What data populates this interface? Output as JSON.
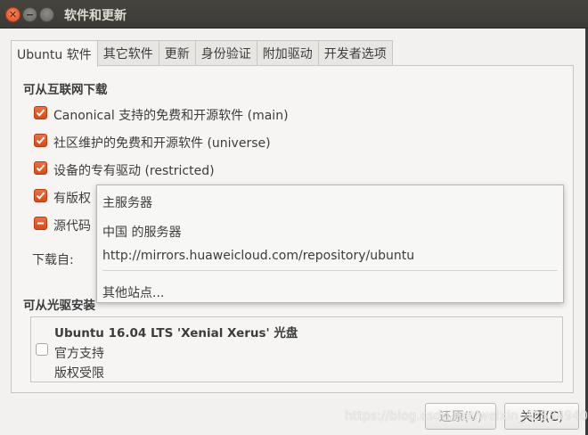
{
  "window": {
    "title": "软件和更新"
  },
  "tabs": [
    {
      "label": "Ubuntu 软件",
      "active": true
    },
    {
      "label": "其它软件"
    },
    {
      "label": "更新"
    },
    {
      "label": "身份验证"
    },
    {
      "label": "附加驱动"
    },
    {
      "label": "开发者选项"
    }
  ],
  "internet": {
    "heading": "可从互联网下载",
    "options": [
      {
        "label": "Canonical 支持的免费和开源软件 (main)",
        "checked": true
      },
      {
        "label": "社区维护的免费和开源软件 (universe)",
        "checked": true
      },
      {
        "label": "设备的专有驱动 (restricted)",
        "checked": true
      },
      {
        "label": "有版权",
        "checked": true
      },
      {
        "label": "源代码",
        "checked": "mixed"
      }
    ],
    "download_from_label": "下载自:"
  },
  "server_menu": {
    "items": [
      "主服务器",
      "中国 的服务器",
      "http://mirrors.huaweicloud.com/repository/ubuntu",
      "其他站点..."
    ]
  },
  "cdrom": {
    "heading": "可从光驱安装",
    "entry_title": "Ubuntu 16.04 LTS 'Xenial Xerus' 光盘",
    "entry_lines": [
      "官方支持",
      "版权受限"
    ]
  },
  "buttons": {
    "revert": "还原(V)",
    "close": "关闭(C)"
  },
  "watermark": "https://blog.csdn.net/weixin_42534940",
  "colors": {
    "accent": "#dd4814",
    "titlebar": "#3b3a36",
    "background": "#f2f1f0"
  }
}
